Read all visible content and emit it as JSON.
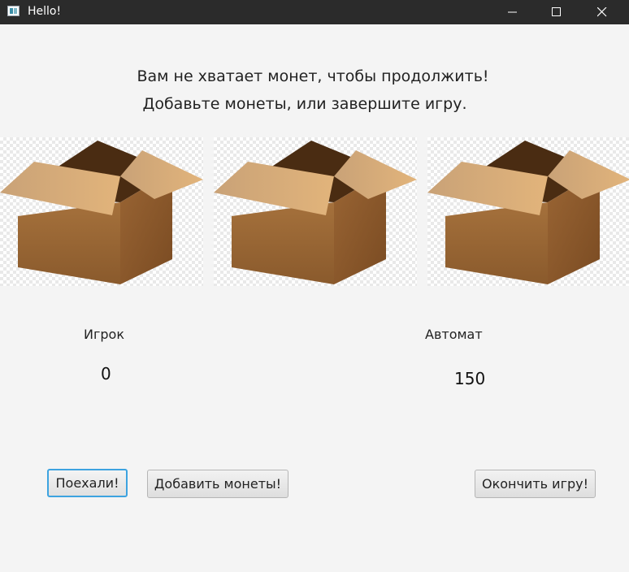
{
  "window": {
    "title": "Hello!",
    "icons": {
      "minimize": "minimize-icon",
      "maximize": "maximize-icon",
      "close": "close-icon"
    }
  },
  "message": {
    "line1": "Вам не хватает монет, чтобы продолжить!",
    "line2": "Добавьте монеты, или завершите игру."
  },
  "slots": [
    {
      "image": "open-cardboard-box"
    },
    {
      "image": "open-cardboard-box"
    },
    {
      "image": "open-cardboard-box"
    }
  ],
  "player": {
    "label": "Игрок",
    "coins": "0"
  },
  "machine": {
    "label": "Автомат",
    "coins": "150"
  },
  "buttons": {
    "go": "Поехали!",
    "add_coins": "Добавить монеты!",
    "end_game": "Окончить игру!"
  },
  "colors": {
    "titlebar": "#2b2b2b",
    "background": "#f4f4f4",
    "focus": "#3da3e0",
    "box_light": "#d4a76a",
    "box_dark": "#8c5a2b"
  }
}
